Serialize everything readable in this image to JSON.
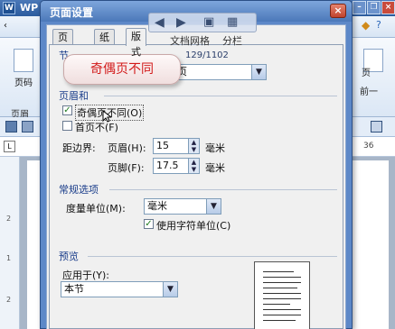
{
  "app": {
    "title": "WP",
    "ribbon_group_label": "页眉",
    "ribbon_button_label": "页码",
    "right_label_1": "页",
    "right_label_2": "前一",
    "ruler_number": "36",
    "ruler_side_numbers": [
      "2",
      "1",
      "2"
    ]
  },
  "toolbar_overlay": {
    "prev": "◀",
    "next": "▶",
    "tab_a": "文档网格",
    "tab_b": "分栏"
  },
  "callout": {
    "text": "奇偶页不同"
  },
  "page_indicator": "129/1102",
  "dialog": {
    "title": "页面设置",
    "close": "×",
    "tabs": [
      "页边距",
      "纸张",
      "版式"
    ],
    "active_tab": 2,
    "section_label_top": "节",
    "section_start_combo": "页",
    "header_footer": {
      "title": "页眉和",
      "odd_even": {
        "label": "奇偶页不同(O)",
        "checked": true
      },
      "first_page": {
        "label": "首页不(F)",
        "checked": false
      },
      "from_edge_label": "距边界:",
      "header_label": "页眉(H):",
      "header_value": "15",
      "footer_label": "页脚(F):",
      "footer_value": "17.5",
      "unit": "毫米"
    },
    "general": {
      "title": "常规选项",
      "measure_label": "度量单位(M):",
      "measure_value": "毫米",
      "char_units": {
        "label": "使用字符单位(C)",
        "checked": true
      }
    },
    "preview": {
      "title": "预览",
      "apply_to_label": "应用于(Y):",
      "apply_to_value": "本节"
    }
  },
  "colors": {
    "dialog_frame": "#5d88c8",
    "callout_text": "#d21a1a",
    "section_title": "#1a3d8a"
  }
}
